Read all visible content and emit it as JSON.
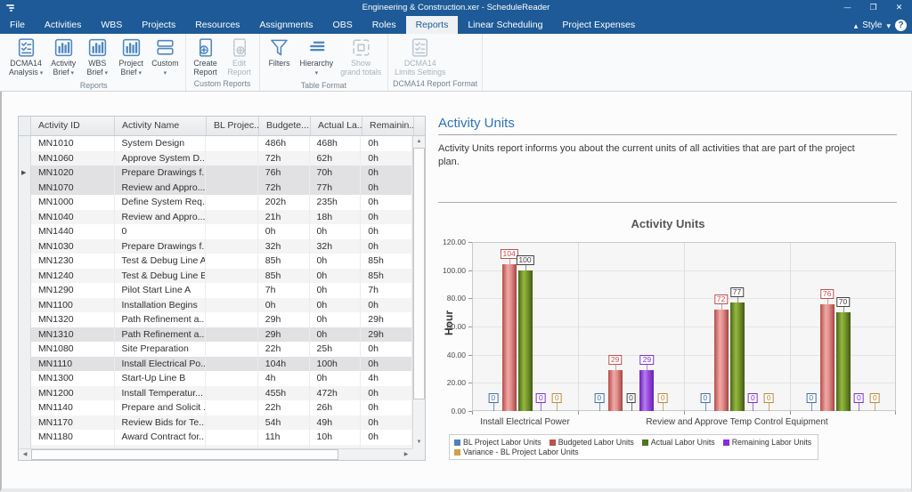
{
  "window": {
    "title": "Engineering & Construction.xer - ScheduleReader"
  },
  "menu": {
    "tabs": [
      "File",
      "Activities",
      "WBS",
      "Projects",
      "Resources",
      "Assignments",
      "OBS",
      "Roles",
      "Reports",
      "Linear Scheduling",
      "Project Expenses"
    ],
    "active_tab": "Reports",
    "style_label": "Style"
  },
  "ribbon": {
    "groups": [
      {
        "label": "Reports",
        "buttons": [
          {
            "lines": [
              "DCMA14",
              "Analysis"
            ],
            "icon": "dcma-checklist",
            "arrow": true,
            "disabled": false
          },
          {
            "lines": [
              "Activity",
              "Brief"
            ],
            "icon": "bar-chart",
            "arrow": true,
            "disabled": false
          },
          {
            "lines": [
              "WBS",
              "Brief"
            ],
            "icon": "bar-chart",
            "arrow": true,
            "disabled": false
          },
          {
            "lines": [
              "Project",
              "Brief"
            ],
            "icon": "bar-chart",
            "arrow": true,
            "disabled": false
          },
          {
            "lines": [
              "Custom",
              ""
            ],
            "icon": "stacked-rows",
            "arrow": true,
            "disabled": false
          }
        ]
      },
      {
        "label": "Custom Reports",
        "buttons": [
          {
            "lines": [
              "Create",
              "Report"
            ],
            "icon": "report-add",
            "arrow": false,
            "disabled": false
          },
          {
            "lines": [
              "Edit",
              "Report"
            ],
            "icon": "report-edit",
            "arrow": false,
            "disabled": true
          }
        ]
      },
      {
        "label": "Table Format",
        "buttons": [
          {
            "lines": [
              "Filters",
              ""
            ],
            "icon": "funnel",
            "arrow": false,
            "disabled": false
          },
          {
            "lines": [
              "Hierarchy",
              ""
            ],
            "icon": "hierarchy",
            "arrow": true,
            "disabled": false
          },
          {
            "lines": [
              "Show",
              "grand totals"
            ],
            "icon": "grand-totals",
            "arrow": false,
            "disabled": true
          }
        ]
      },
      {
        "label": "DCMA14 Report Format",
        "buttons": [
          {
            "lines": [
              "DCMA14",
              "Limits Settings"
            ],
            "icon": "dcma-checklist",
            "arrow": false,
            "disabled": true
          }
        ]
      }
    ]
  },
  "table": {
    "columns": [
      "Activity ID",
      "Activity Name",
      "BL Projec...",
      "Budgete...",
      "Actual La...",
      "Remainin..."
    ],
    "rows": [
      {
        "id": "MN1010",
        "name": "System Design",
        "bl": "",
        "budgeted": "486h",
        "actual": "468h",
        "remaining": "0h",
        "selected": false,
        "current": false
      },
      {
        "id": "MN1060",
        "name": "Approve System D...",
        "bl": "",
        "budgeted": "72h",
        "actual": "62h",
        "remaining": "0h",
        "selected": false,
        "current": false
      },
      {
        "id": "MN1020",
        "name": "Prepare Drawings f...",
        "bl": "",
        "budgeted": "76h",
        "actual": "70h",
        "remaining": "0h",
        "selected": true,
        "current": true
      },
      {
        "id": "MN1070",
        "name": "Review and Appro...",
        "bl": "",
        "budgeted": "72h",
        "actual": "77h",
        "remaining": "0h",
        "selected": true,
        "current": false
      },
      {
        "id": "MN1000",
        "name": "Define System Req...",
        "bl": "",
        "budgeted": "202h",
        "actual": "235h",
        "remaining": "0h",
        "selected": false,
        "current": false
      },
      {
        "id": "MN1040",
        "name": "Review and Appro...",
        "bl": "",
        "budgeted": "21h",
        "actual": "18h",
        "remaining": "0h",
        "selected": false,
        "current": false
      },
      {
        "id": "MN1440",
        "name": "0",
        "bl": "",
        "budgeted": "0h",
        "actual": "0h",
        "remaining": "0h",
        "selected": false,
        "current": false
      },
      {
        "id": "MN1030",
        "name": "Prepare Drawings f...",
        "bl": "",
        "budgeted": "32h",
        "actual": "32h",
        "remaining": "0h",
        "selected": false,
        "current": false
      },
      {
        "id": "MN1230",
        "name": "Test & Debug Line A",
        "bl": "",
        "budgeted": "85h",
        "actual": "0h",
        "remaining": "85h",
        "selected": false,
        "current": false
      },
      {
        "id": "MN1240",
        "name": "Test & Debug Line B",
        "bl": "",
        "budgeted": "85h",
        "actual": "0h",
        "remaining": "85h",
        "selected": false,
        "current": false
      },
      {
        "id": "MN1290",
        "name": "Pilot Start Line A",
        "bl": "",
        "budgeted": "7h",
        "actual": "0h",
        "remaining": "7h",
        "selected": false,
        "current": false
      },
      {
        "id": "MN1100",
        "name": "Installation Begins",
        "bl": "",
        "budgeted": "0h",
        "actual": "0h",
        "remaining": "0h",
        "selected": false,
        "current": false
      },
      {
        "id": "MN1320",
        "name": "Path Refinement a...",
        "bl": "",
        "budgeted": "29h",
        "actual": "0h",
        "remaining": "29h",
        "selected": false,
        "current": false
      },
      {
        "id": "MN1310",
        "name": "Path Refinement a...",
        "bl": "",
        "budgeted": "29h",
        "actual": "0h",
        "remaining": "29h",
        "selected": true,
        "current": false
      },
      {
        "id": "MN1080",
        "name": "Site Preparation",
        "bl": "",
        "budgeted": "22h",
        "actual": "25h",
        "remaining": "0h",
        "selected": false,
        "current": false
      },
      {
        "id": "MN1110",
        "name": "Install Electrical Po...",
        "bl": "",
        "budgeted": "104h",
        "actual": "100h",
        "remaining": "0h",
        "selected": true,
        "current": false
      },
      {
        "id": "MN1300",
        "name": "Start-Up Line B",
        "bl": "",
        "budgeted": "4h",
        "actual": "0h",
        "remaining": "4h",
        "selected": false,
        "current": false
      },
      {
        "id": "MN1200",
        "name": "Install Temperatur...",
        "bl": "",
        "budgeted": "455h",
        "actual": "472h",
        "remaining": "0h",
        "selected": false,
        "current": false
      },
      {
        "id": "MN1140",
        "name": "Prepare and Solicit ...",
        "bl": "",
        "budgeted": "22h",
        "actual": "26h",
        "remaining": "0h",
        "selected": false,
        "current": false
      },
      {
        "id": "MN1170",
        "name": "Review Bids for Te...",
        "bl": "",
        "budgeted": "54h",
        "actual": "49h",
        "remaining": "0h",
        "selected": false,
        "current": false
      },
      {
        "id": "MN1180",
        "name": "Award Contract for...",
        "bl": "",
        "budgeted": "11h",
        "actual": "10h",
        "remaining": "0h",
        "selected": false,
        "current": false
      }
    ]
  },
  "report": {
    "title": "Activity Units",
    "description": "Activity Units report informs you about the current units of all activities that are part of the project plan."
  },
  "chart_data": {
    "type": "bar",
    "title": "Activity Units",
    "ylabel": "Hour",
    "ylim": [
      0,
      120
    ],
    "ytick_step": 20,
    "grid": true,
    "legend_position": "bottom",
    "categories": [
      "Install Electrical Power",
      "",
      "Review and Approve Temp Control Equipment",
      ""
    ],
    "series": [
      {
        "name": "BL Project Labor Units",
        "color": "#4f81bd",
        "label_color": "#3e6fa8",
        "values": [
          0,
          0,
          0,
          0
        ]
      },
      {
        "name": "Budgeted Labor Units",
        "color": "#c0504d",
        "label_color": "#c0504d",
        "values": [
          104,
          29,
          72,
          76
        ]
      },
      {
        "name": "Actual Labor Units",
        "color": "#4e7520",
        "label_color": "#404040",
        "values": [
          100,
          0,
          77,
          70
        ]
      },
      {
        "name": "Remaining Labor Units",
        "color": "#8a2be2",
        "label_color": "#7d2fd0",
        "values": [
          0,
          29,
          0,
          0
        ]
      },
      {
        "name": "Variance - BL Project Labor Units",
        "color": "#d0a04a",
        "label_color": "#b8893a",
        "values": [
          0,
          0,
          0,
          0
        ]
      }
    ]
  }
}
